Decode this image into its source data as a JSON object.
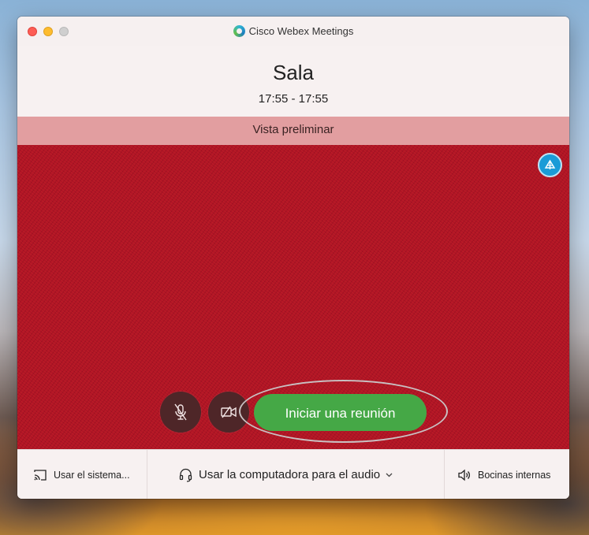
{
  "window": {
    "title": "Cisco Webex Meetings"
  },
  "meeting": {
    "name": "Sala",
    "time": "17:55 - 17:55"
  },
  "preview": {
    "label": "Vista preliminar"
  },
  "controls": {
    "start_button": "Iniciar una reunión"
  },
  "bottom_bar": {
    "share_label": "Usar el sistema...",
    "audio_label": "Usar la computadora para el audio",
    "speaker_label": "Bocinas internas"
  },
  "colors": {
    "video_bg": "#b21426",
    "start_button": "#45a846",
    "layout_button": "#1a9bd7",
    "preview_bar": "#e29ea0"
  }
}
